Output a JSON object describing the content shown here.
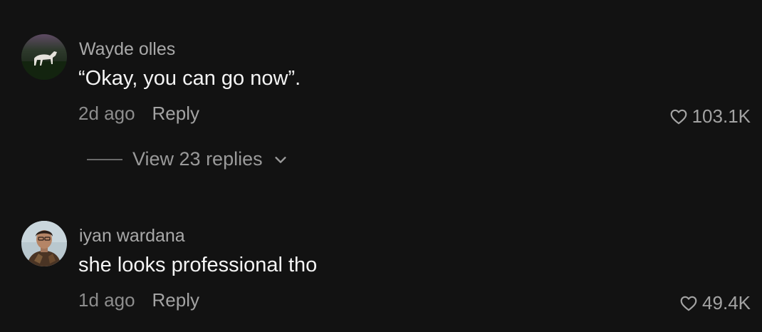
{
  "comments": [
    {
      "username": "Wayde olles",
      "text": "“Okay, you can go now”.",
      "time": "2d ago",
      "reply_label": "Reply",
      "likes": "103.1K",
      "view_replies_label": "View 23 replies"
    },
    {
      "username": "iyan wardana",
      "text": "she looks professional tho",
      "time": "1d ago",
      "reply_label": "Reply",
      "likes": "49.4K"
    }
  ],
  "icons": {
    "like": "heart-outline-icon",
    "expand": "chevron-down-icon"
  },
  "colors": {
    "background": "#121212",
    "primary_text": "#f4f4f4",
    "secondary_text": "#a9a9a9"
  }
}
